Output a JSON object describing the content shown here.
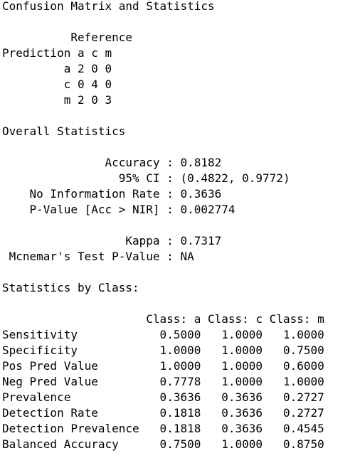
{
  "console": {
    "lines": [
      "Confusion Matrix and Statistics",
      "",
      "          Reference",
      "Prediction a c m",
      "         a 2 0 0",
      "         c 0 4 0",
      "         m 2 0 3",
      "",
      "Overall Statistics",
      "",
      "               Accuracy : 0.8182",
      "                 95% CI : (0.4822, 0.9772)",
      "    No Information Rate : 0.3636",
      "    P-Value [Acc > NIR] : 0.002774",
      "",
      "                  Kappa : 0.7317",
      " Mcnemar's Test P-Value : NA",
      "",
      "Statistics by Class:",
      "",
      "                     Class: a Class: c Class: m",
      "Sensitivity            0.5000   1.0000   1.0000",
      "Specificity            1.0000   1.0000   0.7500",
      "Pos Pred Value         1.0000   1.0000   0.6000",
      "Neg Pred Value         0.7778   1.0000   1.0000",
      "Prevalence             0.3636   0.3636   0.2727",
      "Detection Rate         0.1818   0.3636   0.2727",
      "Detection Prevalence   0.1818   0.3636   0.4545",
      "Balanced Accuracy      0.7500   1.0000   0.8750"
    ]
  }
}
